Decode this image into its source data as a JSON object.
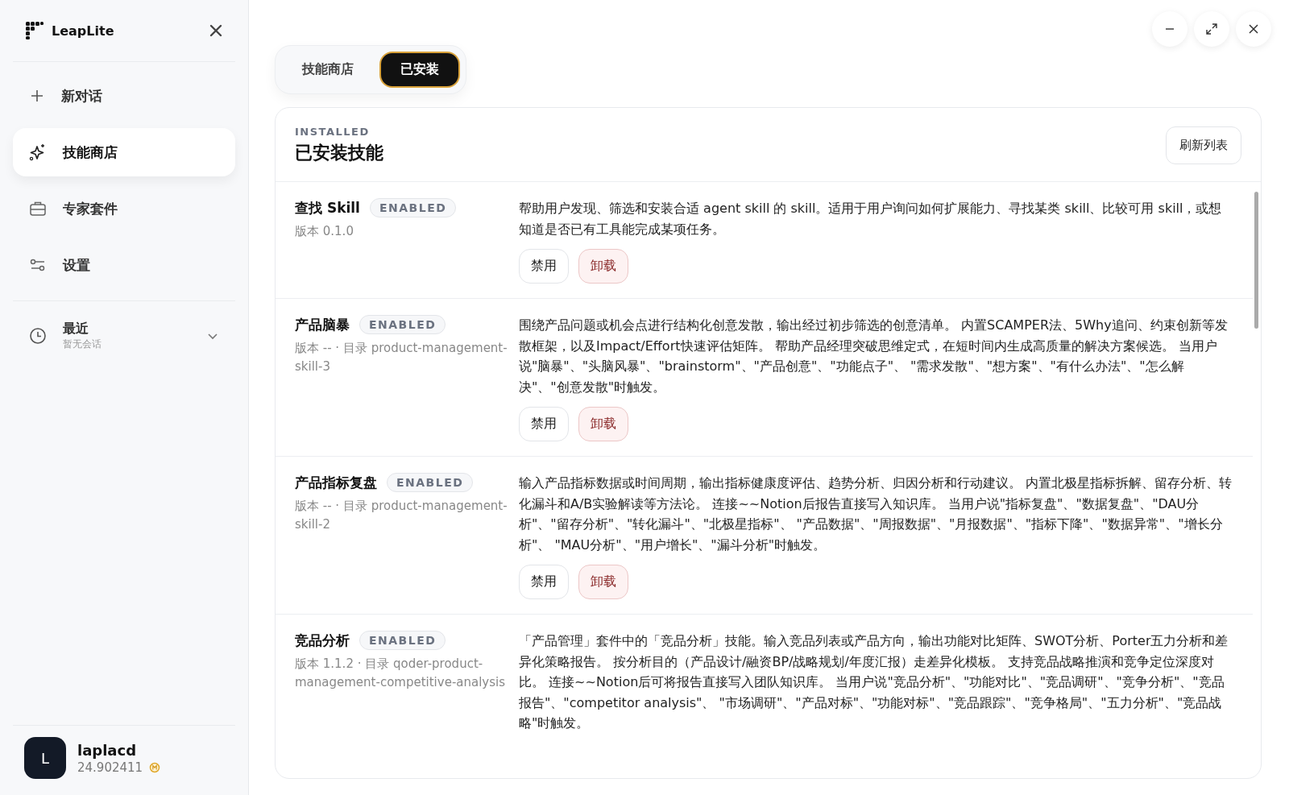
{
  "app": {
    "name": "LeapLite"
  },
  "sidebar": {
    "items": [
      {
        "label": "新对话",
        "kind": "new",
        "selected": false
      },
      {
        "label": "技能商店",
        "kind": "skills",
        "selected": true
      },
      {
        "label": "专家套件",
        "kind": "kits",
        "selected": false
      },
      {
        "label": "设置",
        "kind": "settings",
        "selected": false
      }
    ],
    "recent": {
      "title": "最近",
      "subtitle": "暂无会话",
      "expanded": false
    },
    "user": {
      "initial": "L",
      "name": "laplacd",
      "balance": "24.902411"
    }
  },
  "tabs": [
    {
      "label": "技能商店",
      "selected": false
    },
    {
      "label": "已安装",
      "selected": true
    }
  ],
  "panel": {
    "eyebrow": "INSTALLED",
    "title": "已安装技能",
    "refresh_button": "刷新列表"
  },
  "skills": [
    {
      "name": "查找 Skill",
      "status": "ENABLED",
      "meta": "版本 0.1.0",
      "description": "帮助用户发现、筛选和安装合适 agent skill 的 skill。适用于用户询问如何扩展能力、寻找某类 skill、比较可用 skill，或想知道是否已有工具能完成某项任务。",
      "actions": [
        "禁用",
        "卸载"
      ]
    },
    {
      "name": "产品脑暴",
      "status": "ENABLED",
      "meta": "版本 -- · 目录 product-management-skill-3",
      "description": "围绕产品问题或机会点进行结构化创意发散，输出经过初步筛选的创意清单。 内置SCAMPER法、5Why追问、约束创新等发散框架，以及Impact/Effort快速评估矩阵。 帮助产品经理突破思维定式，在短时间内生成高质量的解决方案候选。 当用户说\"脑暴\"、\"头脑风暴\"、\"brainstorm\"、\"产品创意\"、\"功能点子\"、 \"需求发散\"、\"想方案\"、\"有什么办法\"、\"怎么解决\"、\"创意发散\"时触发。",
      "actions": [
        "禁用",
        "卸载"
      ]
    },
    {
      "name": "产品指标复盘",
      "status": "ENABLED",
      "meta": "版本 -- · 目录 product-management-skill-2",
      "description": "输入产品指标数据或时间周期，输出指标健康度评估、趋势分析、归因分析和行动建议。 内置北极星指标拆解、留存分析、转化漏斗和A/B实验解读等方法论。 连接~~Notion后报告直接写入知识库。 当用户说\"指标复盘\"、\"数据复盘\"、\"DAU分析\"、\"留存分析\"、\"转化漏斗\"、\"北极星指标\"、 \"产品数据\"、\"周报数据\"、\"月报数据\"、\"指标下降\"、\"数据异常\"、\"增长分析\"、 \"MAU分析\"、\"用户增长\"、\"漏斗分析\"时触发。",
      "actions": [
        "禁用",
        "卸载"
      ]
    },
    {
      "name": "竞品分析",
      "status": "ENABLED",
      "meta": "版本 1.1.2 · 目录 qoder-product-management-competitive-analysis",
      "description": "「产品管理」套件中的「竞品分析」技能。输入竞品列表或产品方向，输出功能对比矩阵、SWOT分析、Porter五力分析和差异化策略报告。 按分析目的（产品设计/融资BP/战略规划/年度汇报）走差异化模板。 支持竞品战略推演和竞争定位深度对比。 连接~~Notion后可将报告直接写入团队知识库。 当用户说\"竞品分析\"、\"功能对比\"、\"竞品调研\"、\"竞争分析\"、\"竞品报告\"、\"competitor analysis\"、 \"市场调研\"、\"产品对标\"、\"功能对标\"、\"竞品跟踪\"、\"竞争格局\"、\"五力分析\"、\"竞品战略\"时触发。"
    }
  ]
}
